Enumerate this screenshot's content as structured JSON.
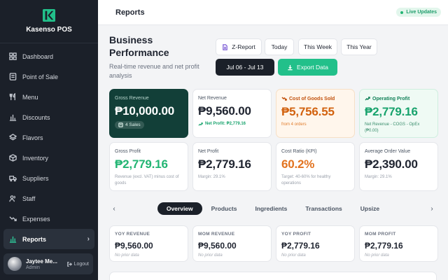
{
  "app": {
    "name": "Kasenso POS"
  },
  "sidebar": {
    "items": [
      {
        "label": "Dashboard",
        "icon": "dashboard-icon"
      },
      {
        "label": "Point of Sale",
        "icon": "pos-icon"
      },
      {
        "label": "Menu",
        "icon": "utensils-icon"
      },
      {
        "label": "Discounts",
        "icon": "discount-icon"
      },
      {
        "label": "Flavors",
        "icon": "layers-icon"
      },
      {
        "label": "Inventory",
        "icon": "box-icon"
      },
      {
        "label": "Suppliers",
        "icon": "truck-icon"
      },
      {
        "label": "Staff",
        "icon": "users-icon"
      },
      {
        "label": "Expenses",
        "icon": "trend-down-icon"
      },
      {
        "label": "Reports",
        "icon": "bar-chart-icon",
        "active": true
      }
    ],
    "user": {
      "name": "Jaytee Me...",
      "role": "Admin",
      "logout_label": "Logout"
    }
  },
  "topbar": {
    "title": "Reports",
    "live_label": "Live Updates"
  },
  "header": {
    "title": "Business Performance",
    "subtitle": "Real-time revenue and net profit analysis"
  },
  "actions": {
    "z_report": "Z-Report",
    "today": "Today",
    "this_week": "This Week",
    "this_year": "This Year",
    "date_range": "Jul 06 - Jul 13",
    "export": "Export Data"
  },
  "kpis": {
    "gross_revenue": {
      "label": "Gross Revenue",
      "value": "₱10,000.00",
      "chip": "4 Sales"
    },
    "net_revenue": {
      "label": "Net Revenue",
      "value": "₱9,560.00",
      "sub": "Net Profit: ₱2,779.16"
    },
    "cogs": {
      "label": "Cost of Goods Sold",
      "value": "₱5,756.55",
      "sub": "from 4 orders"
    },
    "operating_profit": {
      "label": "Operating Profit",
      "value": "₱2,779.16",
      "sub": "Net Revenue - COGS - OpEx (₱0.00)"
    },
    "gross_profit": {
      "label": "Gross Profit",
      "value": "₱2,779.16",
      "sub": "Revenue (excl. VAT) minus cost of goods"
    },
    "net_profit": {
      "label": "Net Profit",
      "value": "₱2,779.16",
      "sub": "Margin: 29.1%"
    },
    "cost_ratio": {
      "label": "Cost Ratio (KPI)",
      "value": "60.2%",
      "sub": "Target: 40-60% for healthy operations"
    },
    "avg_order": {
      "label": "Average Order Value",
      "value": "₱2,390.00",
      "sub": "Margin: 29.1%"
    }
  },
  "tabs": [
    "Overview",
    "Products",
    "Ingredients",
    "Transactions",
    "Upsize"
  ],
  "comparisons": [
    {
      "label": "YOY REVENUE",
      "value": "₱9,560.00",
      "sub": "No prior data"
    },
    {
      "label": "MOM REVENUE",
      "value": "₱9,560.00",
      "sub": "No prior data"
    },
    {
      "label": "YOY PROFIT",
      "value": "₱2,779.16",
      "sub": "No prior data"
    },
    {
      "label": "MOM PROFIT",
      "value": "₱2,779.16",
      "sub": "No prior data"
    }
  ],
  "colors": {
    "sidebar_bg": "#1b2029",
    "accent_green": "#22c08a",
    "dark_card": "#123f38",
    "orange": "#d2620f"
  }
}
